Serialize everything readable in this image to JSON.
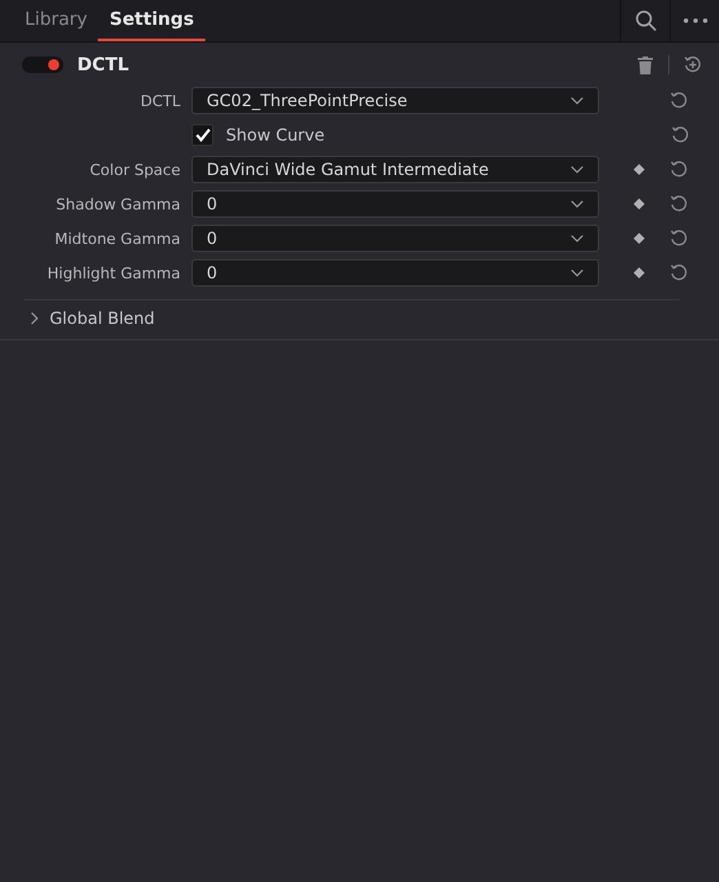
{
  "tabs": [
    {
      "label": "Library",
      "selected": false
    },
    {
      "label": "Settings",
      "selected": true
    }
  ],
  "effect": {
    "title": "DCTL",
    "on": true
  },
  "params": [
    {
      "kind": "dropdown",
      "label": "DCTL",
      "value": "GC02_ThreePointPrecise",
      "keyframe": false
    },
    {
      "kind": "checkbox",
      "label": "Show Curve",
      "checked": true
    },
    {
      "kind": "dropdown",
      "label": "Color Space",
      "value": "DaVinci Wide Gamut Intermediate",
      "keyframe": true
    },
    {
      "kind": "dropdown",
      "label": "Shadow Gamma",
      "value": "0",
      "keyframe": true
    },
    {
      "kind": "dropdown",
      "label": "Midtone Gamma",
      "value": "0",
      "keyframe": true
    },
    {
      "kind": "dropdown",
      "label": "Highlight Gamma",
      "value": "0",
      "keyframe": true
    }
  ],
  "sections": [
    {
      "label": "Global Blend",
      "expanded": false
    }
  ]
}
